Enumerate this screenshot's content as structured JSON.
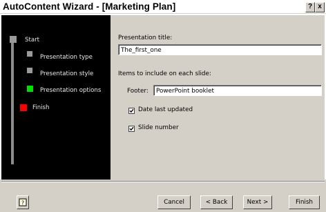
{
  "window": {
    "title": "AutoContent Wizard - [Marketing Plan]",
    "help_glyph": "?",
    "close_glyph": "x"
  },
  "steps": [
    {
      "label": "Start",
      "state": "done",
      "color": "#9a9a9a"
    },
    {
      "label": "Presentation type",
      "state": "done",
      "color": "#9a9a9a"
    },
    {
      "label": "Presentation style",
      "state": "done",
      "color": "#9a9a9a"
    },
    {
      "label": "Presentation options",
      "state": "current",
      "color": "#00e000"
    },
    {
      "label": "Finish",
      "state": "pending",
      "color": "#ff0000"
    }
  ],
  "form": {
    "presentation_title_label": "Presentation title:",
    "presentation_title_value": "The_first_one",
    "items_label": "Items to include on each slide:",
    "footer_label": "Footer:",
    "footer_value": "PowerPoint booklet",
    "date_label": "Date last updated",
    "date_checked": true,
    "slide_number_label": "Slide number",
    "slide_number_checked": true
  },
  "buttons": {
    "help_icon": "help-icon",
    "cancel": "Cancel",
    "back": "< Back",
    "next": "Next >",
    "finish": "Finish"
  },
  "colors": {
    "dialog_face": "#d4d0c8",
    "left_panel": "#000000",
    "current_step": "#00e000",
    "finish_step": "#ff0000"
  }
}
